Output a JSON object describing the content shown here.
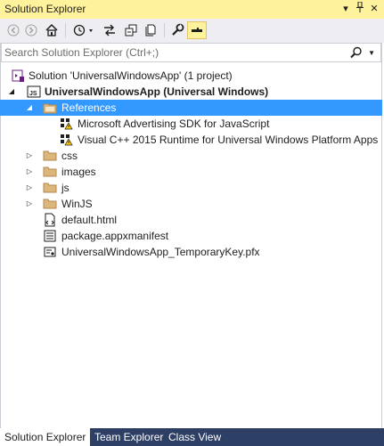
{
  "window": {
    "title": "Solution Explorer",
    "dropdown_glyph": "▾",
    "pin_glyph": "⊥",
    "close_glyph": "✕"
  },
  "toolbar": {
    "buttons": [
      "back-arrow-icon",
      "forward-arrow-icon",
      "home-icon",
      "history-icon",
      "sync-icon",
      "collapse-all-icon",
      "show-all-files-icon",
      "properties-wrench-icon",
      "preview-selected-icon"
    ]
  },
  "search": {
    "placeholder": "Search Solution Explorer (Ctrl+;)",
    "value": ""
  },
  "tree": {
    "solution": "Solution 'UniversalWindowsApp' (1 project)",
    "project": "UniversalWindowsApp (Universal Windows)",
    "references": "References",
    "ref_items": [
      "Microsoft Advertising SDK for JavaScript",
      "Visual C++ 2015 Runtime for Universal Windows Platform Apps"
    ],
    "folders": [
      "css",
      "images",
      "js",
      "WinJS"
    ],
    "files": [
      "default.html",
      "package.appxmanifest",
      "UniversalWindowsApp_TemporaryKey.pfx"
    ]
  },
  "tabs": [
    {
      "label": "Solution Explorer",
      "active": true
    },
    {
      "label": "Team Explorer",
      "active": false
    },
    {
      "label": "Class View",
      "active": false
    }
  ],
  "colors": {
    "title_bar": "#fff29d",
    "selection": "#3399ff",
    "tab_strip": "#2d3f64",
    "toolbar": "#eeeef2"
  }
}
